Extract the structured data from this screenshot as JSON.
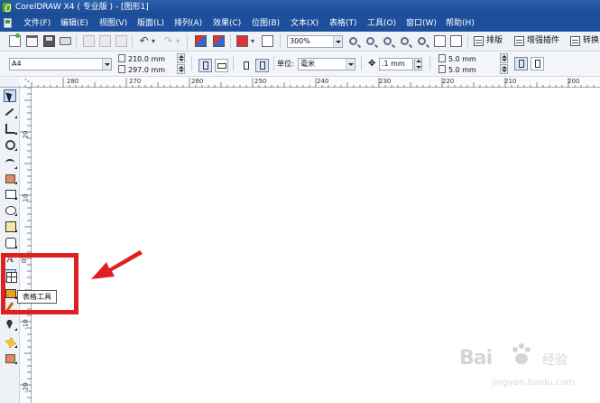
{
  "window": {
    "title": "CorelDRAW X4 ( 专业版 ) - [图形1]"
  },
  "menu": [
    {
      "label": "文件(F)"
    },
    {
      "label": "编辑(E)"
    },
    {
      "label": "视图(V)"
    },
    {
      "label": "版面(L)"
    },
    {
      "label": "排列(A)"
    },
    {
      "label": "效果(C)"
    },
    {
      "label": "位图(B)"
    },
    {
      "label": "文本(X)"
    },
    {
      "label": "表格(T)"
    },
    {
      "label": "工具(O)"
    },
    {
      "label": "窗口(W)"
    },
    {
      "label": "帮助(H)"
    }
  ],
  "standard_toolbar": {
    "zoom_value": "300%",
    "layout_button_label": "排版",
    "plugin_button_label": "增强插件",
    "convert_button_label": "转换"
  },
  "property_bar": {
    "paper_size": "A4",
    "width": "210.0 mm",
    "height": "297.0 mm",
    "units_label": "单位:",
    "units_value": "毫米",
    "nudge_value": ".1 mm",
    "duplicate_x": "5.0 mm",
    "duplicate_y": "5.0 mm"
  },
  "ruler": {
    "top_labels": [
      "280",
      "270",
      "260",
      "250",
      "240",
      "230",
      "220",
      "210",
      "200"
    ],
    "left_labels": [
      "20",
      "10",
      "0",
      "-10",
      "-20"
    ],
    "unit_mark": "毫米"
  },
  "toolbox": {
    "tooltip": "表格工具",
    "tools": [
      {
        "name": "pick-tool-icon"
      },
      {
        "name": "shape-tool-icon"
      },
      {
        "name": "crop-tool-icon"
      },
      {
        "name": "zoom-tool-icon"
      },
      {
        "name": "freehand-tool-icon"
      },
      {
        "name": "smart-fill-tool-icon"
      },
      {
        "name": "rectangle-tool-icon"
      },
      {
        "name": "ellipse-tool-icon"
      },
      {
        "name": "polygon-tool-icon"
      },
      {
        "name": "basic-shapes-tool-icon"
      },
      {
        "name": "text-tool-icon"
      },
      {
        "name": "table-tool-icon"
      },
      {
        "name": "dimension-tool-icon"
      },
      {
        "name": "connector-tool-icon"
      },
      {
        "name": "outline-pen-tool-icon"
      },
      {
        "name": "fill-tool-icon"
      },
      {
        "name": "interactive-fill-tool-icon"
      }
    ]
  },
  "watermark": {
    "brand": "Bai",
    "brand2": "经验",
    "url": "jingyan.baidu.com"
  },
  "colors": {
    "title_bar": "#1c4a95",
    "annotation_red": "#e02020"
  }
}
